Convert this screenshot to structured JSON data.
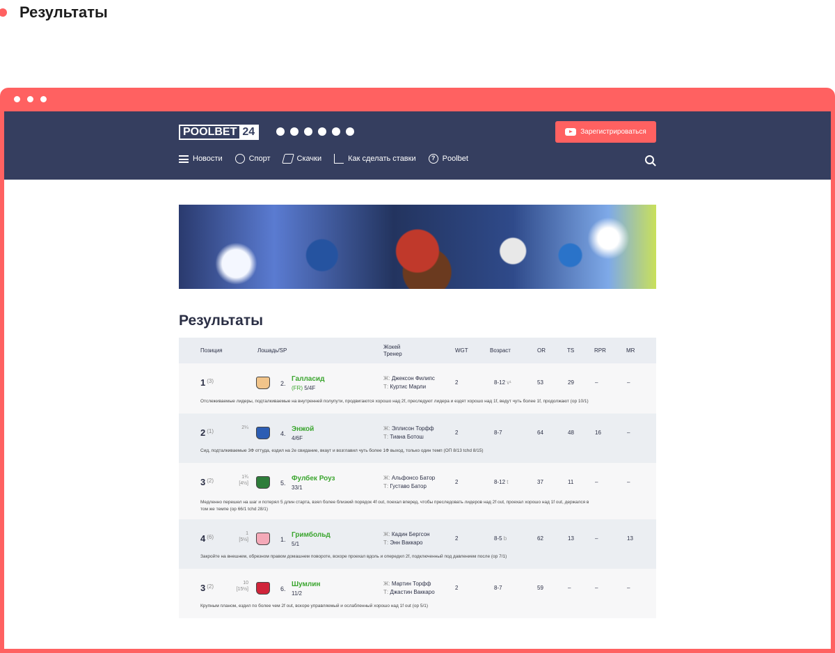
{
  "outer_title": "Результаты",
  "header": {
    "logo_a": "POOLBET",
    "logo_b": "24",
    "social": [
      "instagram-icon",
      "vk-icon",
      "telegram-icon",
      "facebook-icon",
      "odnoklassniki-icon",
      "twitter-icon"
    ],
    "register_label": "Зарегистрироваться",
    "nav": [
      {
        "label": "Новости",
        "icon": "news-list-icon"
      },
      {
        "label": "Спорт",
        "icon": "soccer-ball-icon"
      },
      {
        "label": "Скачки",
        "icon": "horse-icon"
      },
      {
        "label": "Как сделать ставки",
        "icon": "chart-up-icon"
      },
      {
        "label": "Poolbet",
        "icon": "question-icon"
      }
    ]
  },
  "page_title": "Результаты",
  "table": {
    "headers": {
      "position": "Позиция",
      "horse": "Лошадь/SP",
      "jockey": "Жокей",
      "trainer": "Тренер",
      "wgt": "WGT",
      "age": "Возраст",
      "or": "OR",
      "ts": "TS",
      "rpr": "RPR",
      "mr": "MR"
    },
    "rows": [
      {
        "pos": "1",
        "pos_sup": "(3)",
        "dist": "",
        "dist2": "",
        "num": "2.",
        "name": "Галласид",
        "sp_fr": "(FR)",
        "sp": "5/4F",
        "jockey": "Джексон Филипс",
        "trainer": "Куртис Марли",
        "wgt": "2",
        "age": "8-12",
        "age_x": "v¹",
        "or": "53",
        "ts": "29",
        "rpr": "–",
        "mr": "–",
        "silk": "#f1c48a",
        "comment": "Отслеживаемые лидеры, подталкиваемые на внутренней полупути, продвигаются хорошо над 2f, преследуют лидера и ездят хорошо над 1f, ведут чуть более 1f, продолжают (op 10/1)"
      },
      {
        "pos": "2",
        "pos_sup": "(1)",
        "dist": "2¼",
        "dist2": "",
        "num": "4.",
        "name": "Энжой",
        "sp_fr": "",
        "sp": "4/6F",
        "jockey": "Эллисон Торфф",
        "trainer": "Тиана Ботош",
        "wgt": "2",
        "age": "8-7",
        "age_x": "",
        "or": "64",
        "ts": "48",
        "rpr": "16",
        "mr": "–",
        "silk": "#2c5db3",
        "comment": "Сид, подталкиваемые 3Ф оттуда, ездил на 2е свидание, вкаут и возглавил чуть более 1Ф выход, только один темп (ОП 8/13 tchd 8/15)"
      },
      {
        "pos": "3",
        "pos_sup": "(2)",
        "dist": "1¾",
        "dist2": "[4½]",
        "num": "5.",
        "name": "Фулбек Роуз",
        "sp_fr": "",
        "sp": "33/1",
        "jockey": "Альфонсо Батор",
        "trainer": "Густаво Батор",
        "wgt": "2",
        "age": "8-12",
        "age_x": "t",
        "or": "37",
        "ts": "11",
        "rpr": "–",
        "mr": "–",
        "silk": "#2e7d3a",
        "comment": "Медленно перешел на шаг и потерял 5 длин старта, взял более близкий порядок 4f out, поехал вперед, чтобы преследовать лидеров над 2f out, проехал хорошо над 1f out, держался в том же темпе (op 66/1 tchd 28/1)"
      },
      {
        "pos": "4",
        "pos_sup": "(6)",
        "dist": "1",
        "dist2": "[5½]",
        "num": "1.",
        "name": "Гримбольд",
        "sp_fr": "",
        "sp": "5/1",
        "jockey": "Кадин Бергсон",
        "trainer": "Энн Ваккаро",
        "wgt": "2",
        "age": "8-5",
        "age_x": "b",
        "or": "62",
        "ts": "13",
        "rpr": "–",
        "mr": "13",
        "silk": "#f4a9b8",
        "comment": "Закройте на внешнем, обрезном правом домашнем повороте, вскоре проехал вдоль и опередил 2f, подключенный под давлением после (op 7/1)"
      },
      {
        "pos": "3",
        "pos_sup": "(2)",
        "dist": "10",
        "dist2": "[15½]",
        "num": "6.",
        "name": "Шумлин",
        "sp_fr": "",
        "sp": "11/2",
        "jockey": "Мартин Торфф",
        "trainer": "Джастин Ваккаро",
        "wgt": "2",
        "age": "8-7",
        "age_x": "",
        "or": "59",
        "ts": "–",
        "rpr": "–",
        "mr": "–",
        "silk": "#d0243a",
        "comment": "Крупным планом, ездил по более чем 2f out, вскоре управляемый и ослабленный хорошо над 1f out (op 5/1)"
      }
    ]
  },
  "labels": {
    "jockey_prefix": "Ж:",
    "trainer_prefix": "Т:"
  }
}
